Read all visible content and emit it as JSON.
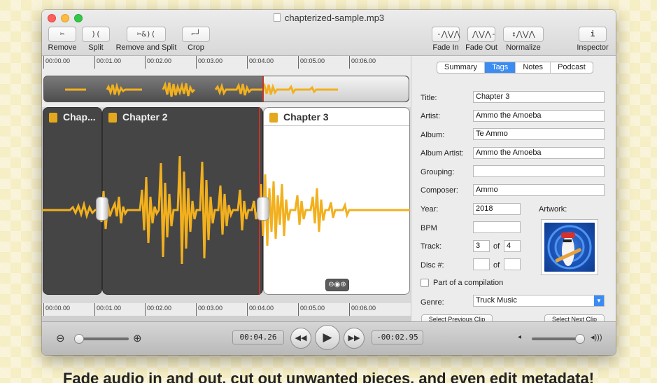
{
  "window": {
    "title": "chapterized-sample.mp3"
  },
  "toolbar": {
    "left": [
      {
        "icon": "scissors-icon",
        "glyph": "✂",
        "label": "Remove"
      },
      {
        "icon": "split-icon",
        "glyph": ")(",
        "label": "Split"
      },
      {
        "icon": "remove-and-split-icon",
        "glyph": "✂&)(",
        "label": "Remove and Split"
      },
      {
        "icon": "crop-icon",
        "glyph": "⌐┘",
        "label": "Crop"
      }
    ],
    "right": [
      {
        "icon": "fade-in-icon",
        "glyph": "-⋀⋁⋀",
        "label": "Fade In"
      },
      {
        "icon": "fade-out-icon",
        "glyph": "⋀⋁⋀-",
        "label": "Fade Out"
      },
      {
        "icon": "normalize-icon",
        "glyph": "↕⋀⋁⋀",
        "label": "Normalize"
      },
      {
        "icon": "info-icon",
        "glyph": "i",
        "label": "Inspector"
      }
    ]
  },
  "ruler": {
    "ticks": [
      "00:00.00",
      "00:01.00",
      "00:02.00",
      "00:03.00",
      "00:04.00",
      "00:05.00",
      "00:06.00"
    ]
  },
  "chapters": [
    {
      "title": "Chap..."
    },
    {
      "title": "Chapter 2"
    },
    {
      "title": "Chapter 3"
    }
  ],
  "inspector": {
    "tabs": [
      "Summary",
      "Tags",
      "Notes",
      "Podcast"
    ],
    "active_tab": "Tags",
    "labels": {
      "title": "Title:",
      "artist": "Artist:",
      "album": "Album:",
      "album_artist": "Album Artist:",
      "grouping": "Grouping:",
      "composer": "Composer:",
      "year": "Year:",
      "artwork": "Artwork:",
      "bpm": "BPM",
      "track": "Track:",
      "disc": "Disc #:",
      "of": "of",
      "compilation": "Part of a compilation",
      "genre": "Genre:"
    },
    "values": {
      "title": "Chapter 3",
      "artist": "Ammo the Amoeba",
      "album": "Te Ammo",
      "album_artist": "Ammo the Amoeba",
      "grouping": "",
      "composer": "Ammo",
      "year": "2018",
      "bpm": "",
      "track": "3",
      "track_total": "4",
      "disc": "",
      "disc_total": "",
      "genre": "Truck Music"
    },
    "buttons": {
      "prev": "Select Previous Clip",
      "next": "Select Next Clip"
    }
  },
  "transport": {
    "current_time": "00:04.26",
    "remaining_time": "-00:02.95"
  },
  "colors": {
    "waveform": "#f2b01e",
    "playhead": "#c0392b",
    "accent": "#3b8bf2"
  },
  "caption": "Fade audio in and out, cut out unwanted pieces, and even edit metadata!"
}
